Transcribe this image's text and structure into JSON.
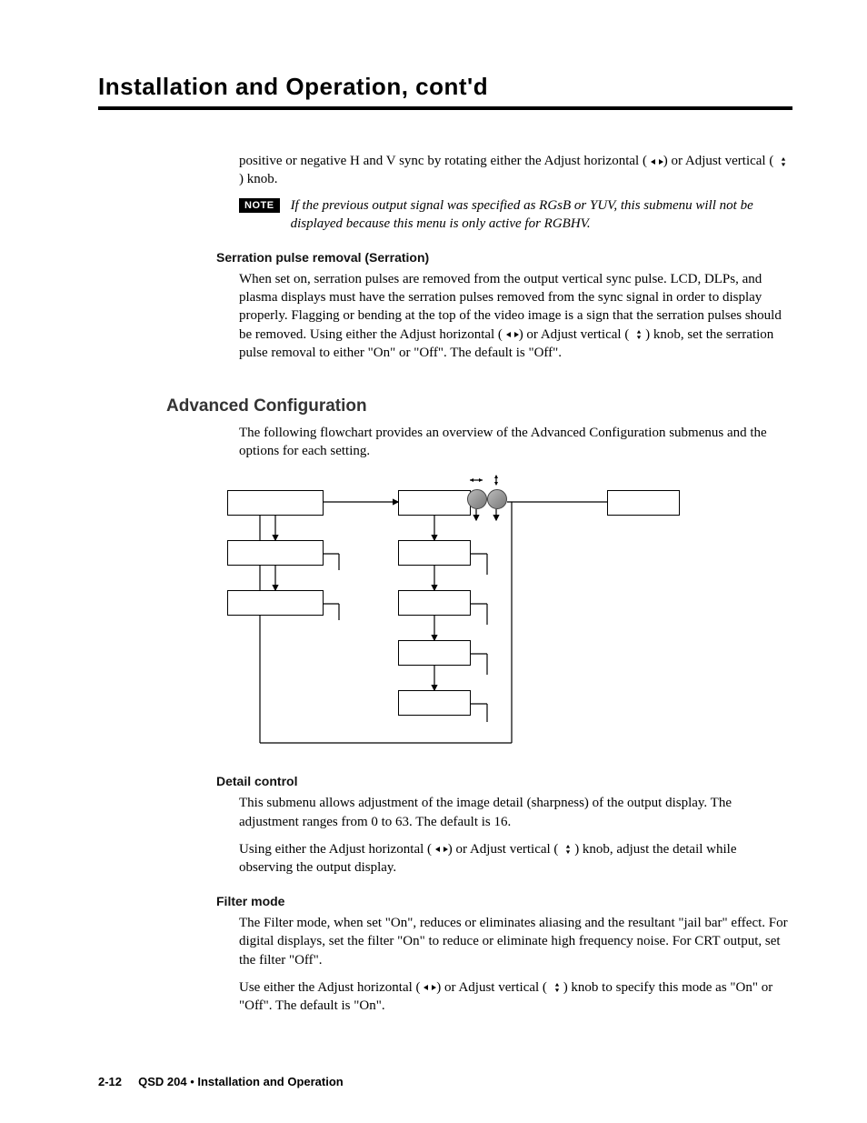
{
  "header": {
    "chapter_title": "Installation and Operation, cont'd"
  },
  "intro": {
    "p1a": "positive or negative H and V sync by rotating either the Adjust horizontal (",
    "p1b": ") or Adjust vertical (",
    "p1c": ") knob."
  },
  "note1": {
    "badge": "NOTE",
    "text": "If the previous output signal was specified as RGsB or YUV, this submenu will not be displayed because this menu is only active for RGBHV."
  },
  "serration": {
    "heading": "Serration pulse removal (Serration)",
    "p1a": "When set on, serration pulses are removed from the output vertical sync pulse. LCD, DLPs, and plasma displays must have the serration pulses removed from the sync signal in order to display properly. Flagging or bending at the top of the video image is a sign that the serration pulses should be removed. Using either the Adjust horizontal (",
    "p1b": ") or Adjust vertical (",
    "p1c": ") knob, set the serration pulse removal to either \"On\" or \"Off\".  The default is \"Off\"."
  },
  "advanced": {
    "heading": "Advanced  Configuration",
    "p1": "The following flowchart provides an overview of the Advanced Configuration submenus and the options for each setting."
  },
  "detail": {
    "heading": "Detail control",
    "p1": "This submenu allows adjustment of the image detail (sharpness) of the output display.  The adjustment ranges from 0 to 63.  The default is 16.",
    "p2a": "Using either the Adjust horizontal (",
    "p2b": ") or Adjust vertical (",
    "p2c": ") knob, adjust the detail while observing the output display."
  },
  "filter": {
    "heading": "Filter mode",
    "p1": "The Filter mode, when set \"On\", reduces or eliminates aliasing and the resultant \"jail bar\" effect.  For digital displays, set the filter \"On\" to reduce or eliminate high frequency noise.  For CRT output, set the filter \"Off\".",
    "p2a": "Use either the Adjust horizontal (",
    "p2b": ") or Adjust vertical (",
    "p2c": ") knob to specify this mode as \"On\" or \"Off\".  The default is \"On\"."
  },
  "footer": {
    "page_number": "2-12",
    "product": "QSD 204",
    "section": "Installation and Operation"
  },
  "icons": {
    "horizontal_symbol": "◂▸",
    "vertical_symbol": "▴▾"
  }
}
